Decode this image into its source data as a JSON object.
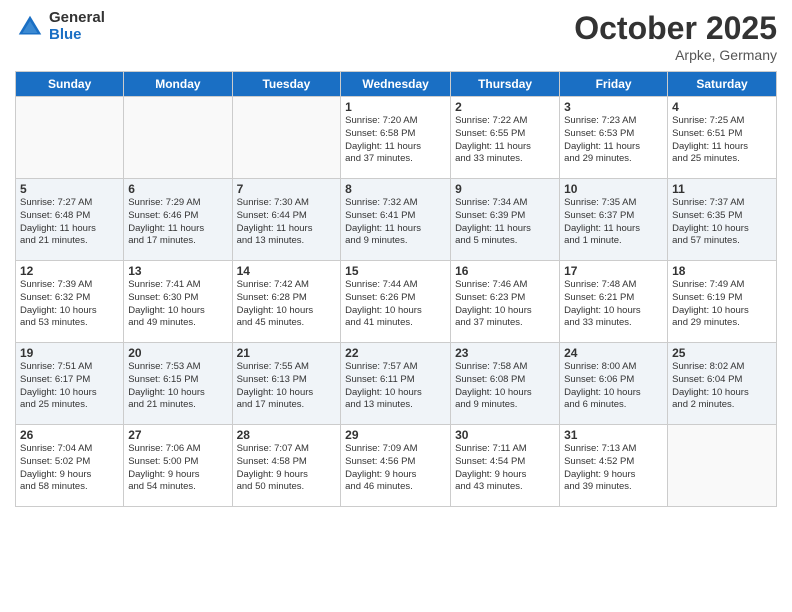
{
  "header": {
    "logo_general": "General",
    "logo_blue": "Blue",
    "month_title": "October 2025",
    "location": "Arpke, Germany"
  },
  "days_of_week": [
    "Sunday",
    "Monday",
    "Tuesday",
    "Wednesday",
    "Thursday",
    "Friday",
    "Saturday"
  ],
  "weeks": [
    [
      {
        "day": "",
        "info": ""
      },
      {
        "day": "",
        "info": ""
      },
      {
        "day": "",
        "info": ""
      },
      {
        "day": "1",
        "info": "Sunrise: 7:20 AM\nSunset: 6:58 PM\nDaylight: 11 hours\nand 37 minutes."
      },
      {
        "day": "2",
        "info": "Sunrise: 7:22 AM\nSunset: 6:55 PM\nDaylight: 11 hours\nand 33 minutes."
      },
      {
        "day": "3",
        "info": "Sunrise: 7:23 AM\nSunset: 6:53 PM\nDaylight: 11 hours\nand 29 minutes."
      },
      {
        "day": "4",
        "info": "Sunrise: 7:25 AM\nSunset: 6:51 PM\nDaylight: 11 hours\nand 25 minutes."
      }
    ],
    [
      {
        "day": "5",
        "info": "Sunrise: 7:27 AM\nSunset: 6:48 PM\nDaylight: 11 hours\nand 21 minutes."
      },
      {
        "day": "6",
        "info": "Sunrise: 7:29 AM\nSunset: 6:46 PM\nDaylight: 11 hours\nand 17 minutes."
      },
      {
        "day": "7",
        "info": "Sunrise: 7:30 AM\nSunset: 6:44 PM\nDaylight: 11 hours\nand 13 minutes."
      },
      {
        "day": "8",
        "info": "Sunrise: 7:32 AM\nSunset: 6:41 PM\nDaylight: 11 hours\nand 9 minutes."
      },
      {
        "day": "9",
        "info": "Sunrise: 7:34 AM\nSunset: 6:39 PM\nDaylight: 11 hours\nand 5 minutes."
      },
      {
        "day": "10",
        "info": "Sunrise: 7:35 AM\nSunset: 6:37 PM\nDaylight: 11 hours\nand 1 minute."
      },
      {
        "day": "11",
        "info": "Sunrise: 7:37 AM\nSunset: 6:35 PM\nDaylight: 10 hours\nand 57 minutes."
      }
    ],
    [
      {
        "day": "12",
        "info": "Sunrise: 7:39 AM\nSunset: 6:32 PM\nDaylight: 10 hours\nand 53 minutes."
      },
      {
        "day": "13",
        "info": "Sunrise: 7:41 AM\nSunset: 6:30 PM\nDaylight: 10 hours\nand 49 minutes."
      },
      {
        "day": "14",
        "info": "Sunrise: 7:42 AM\nSunset: 6:28 PM\nDaylight: 10 hours\nand 45 minutes."
      },
      {
        "day": "15",
        "info": "Sunrise: 7:44 AM\nSunset: 6:26 PM\nDaylight: 10 hours\nand 41 minutes."
      },
      {
        "day": "16",
        "info": "Sunrise: 7:46 AM\nSunset: 6:23 PM\nDaylight: 10 hours\nand 37 minutes."
      },
      {
        "day": "17",
        "info": "Sunrise: 7:48 AM\nSunset: 6:21 PM\nDaylight: 10 hours\nand 33 minutes."
      },
      {
        "day": "18",
        "info": "Sunrise: 7:49 AM\nSunset: 6:19 PM\nDaylight: 10 hours\nand 29 minutes."
      }
    ],
    [
      {
        "day": "19",
        "info": "Sunrise: 7:51 AM\nSunset: 6:17 PM\nDaylight: 10 hours\nand 25 minutes."
      },
      {
        "day": "20",
        "info": "Sunrise: 7:53 AM\nSunset: 6:15 PM\nDaylight: 10 hours\nand 21 minutes."
      },
      {
        "day": "21",
        "info": "Sunrise: 7:55 AM\nSunset: 6:13 PM\nDaylight: 10 hours\nand 17 minutes."
      },
      {
        "day": "22",
        "info": "Sunrise: 7:57 AM\nSunset: 6:11 PM\nDaylight: 10 hours\nand 13 minutes."
      },
      {
        "day": "23",
        "info": "Sunrise: 7:58 AM\nSunset: 6:08 PM\nDaylight: 10 hours\nand 9 minutes."
      },
      {
        "day": "24",
        "info": "Sunrise: 8:00 AM\nSunset: 6:06 PM\nDaylight: 10 hours\nand 6 minutes."
      },
      {
        "day": "25",
        "info": "Sunrise: 8:02 AM\nSunset: 6:04 PM\nDaylight: 10 hours\nand 2 minutes."
      }
    ],
    [
      {
        "day": "26",
        "info": "Sunrise: 7:04 AM\nSunset: 5:02 PM\nDaylight: 9 hours\nand 58 minutes."
      },
      {
        "day": "27",
        "info": "Sunrise: 7:06 AM\nSunset: 5:00 PM\nDaylight: 9 hours\nand 54 minutes."
      },
      {
        "day": "28",
        "info": "Sunrise: 7:07 AM\nSunset: 4:58 PM\nDaylight: 9 hours\nand 50 minutes."
      },
      {
        "day": "29",
        "info": "Sunrise: 7:09 AM\nSunset: 4:56 PM\nDaylight: 9 hours\nand 46 minutes."
      },
      {
        "day": "30",
        "info": "Sunrise: 7:11 AM\nSunset: 4:54 PM\nDaylight: 9 hours\nand 43 minutes."
      },
      {
        "day": "31",
        "info": "Sunrise: 7:13 AM\nSunset: 4:52 PM\nDaylight: 9 hours\nand 39 minutes."
      },
      {
        "day": "",
        "info": ""
      }
    ]
  ]
}
